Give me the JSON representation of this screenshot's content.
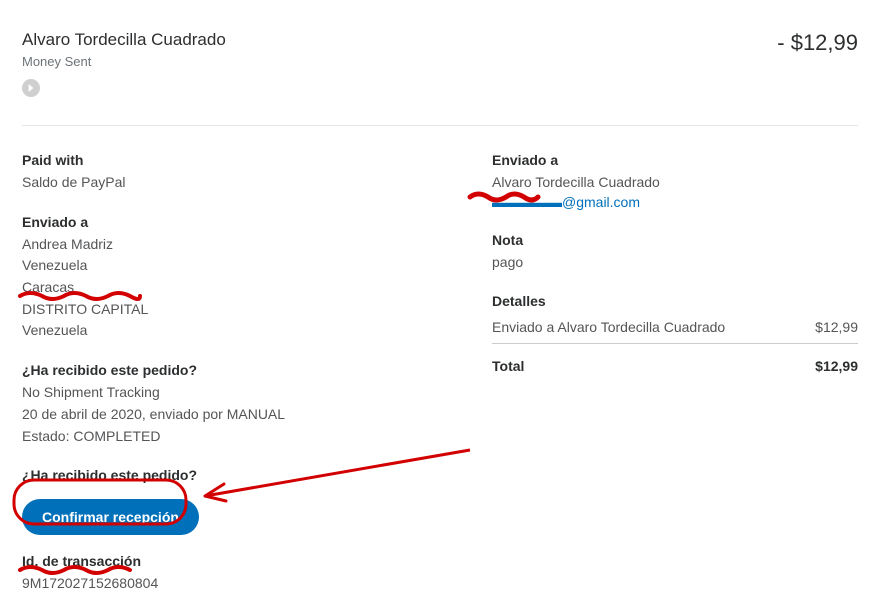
{
  "header": {
    "recipient_name": "Alvaro Tordecilla Cuadrado",
    "subtitle": "Money Sent",
    "amount": "- $12,99"
  },
  "left": {
    "paid_with_heading": "Paid with",
    "paid_with_value": "Saldo de PayPal",
    "enviado_a_heading": "Enviado a",
    "ship_name": "Andrea Madriz",
    "ship_country1": "Venezuela",
    "ship_city": "Caracas",
    "ship_redacted": "DISTRITO CAPITAL",
    "ship_country2": "Venezuela",
    "received_q_heading": "¿Ha recibido este pedido?",
    "tracking_line": "No Shipment Tracking",
    "date_line": "20 de abril de 2020, enviado por MANUAL",
    "status_line": "Estado: COMPLETED",
    "received_q_heading2": "¿Ha recibido este pedido?",
    "confirm_button": "Confirmar recepción",
    "txn_heading": "Id. de transacción",
    "txn_value": "9M172027152680804"
  },
  "right": {
    "enviado_a_heading": "Enviado a",
    "enviado_a_name": "Alvaro Tordecilla Cuadrado",
    "enviado_a_email_suffix": "@gmail.com",
    "nota_heading": "Nota",
    "nota_value": "pago",
    "detalles_heading": "Detalles",
    "detalles_desc": "Enviado a Alvaro Tordecilla Cuadrado",
    "detalles_amount": "$12,99",
    "total_label": "Total",
    "total_amount": "$12,99"
  }
}
